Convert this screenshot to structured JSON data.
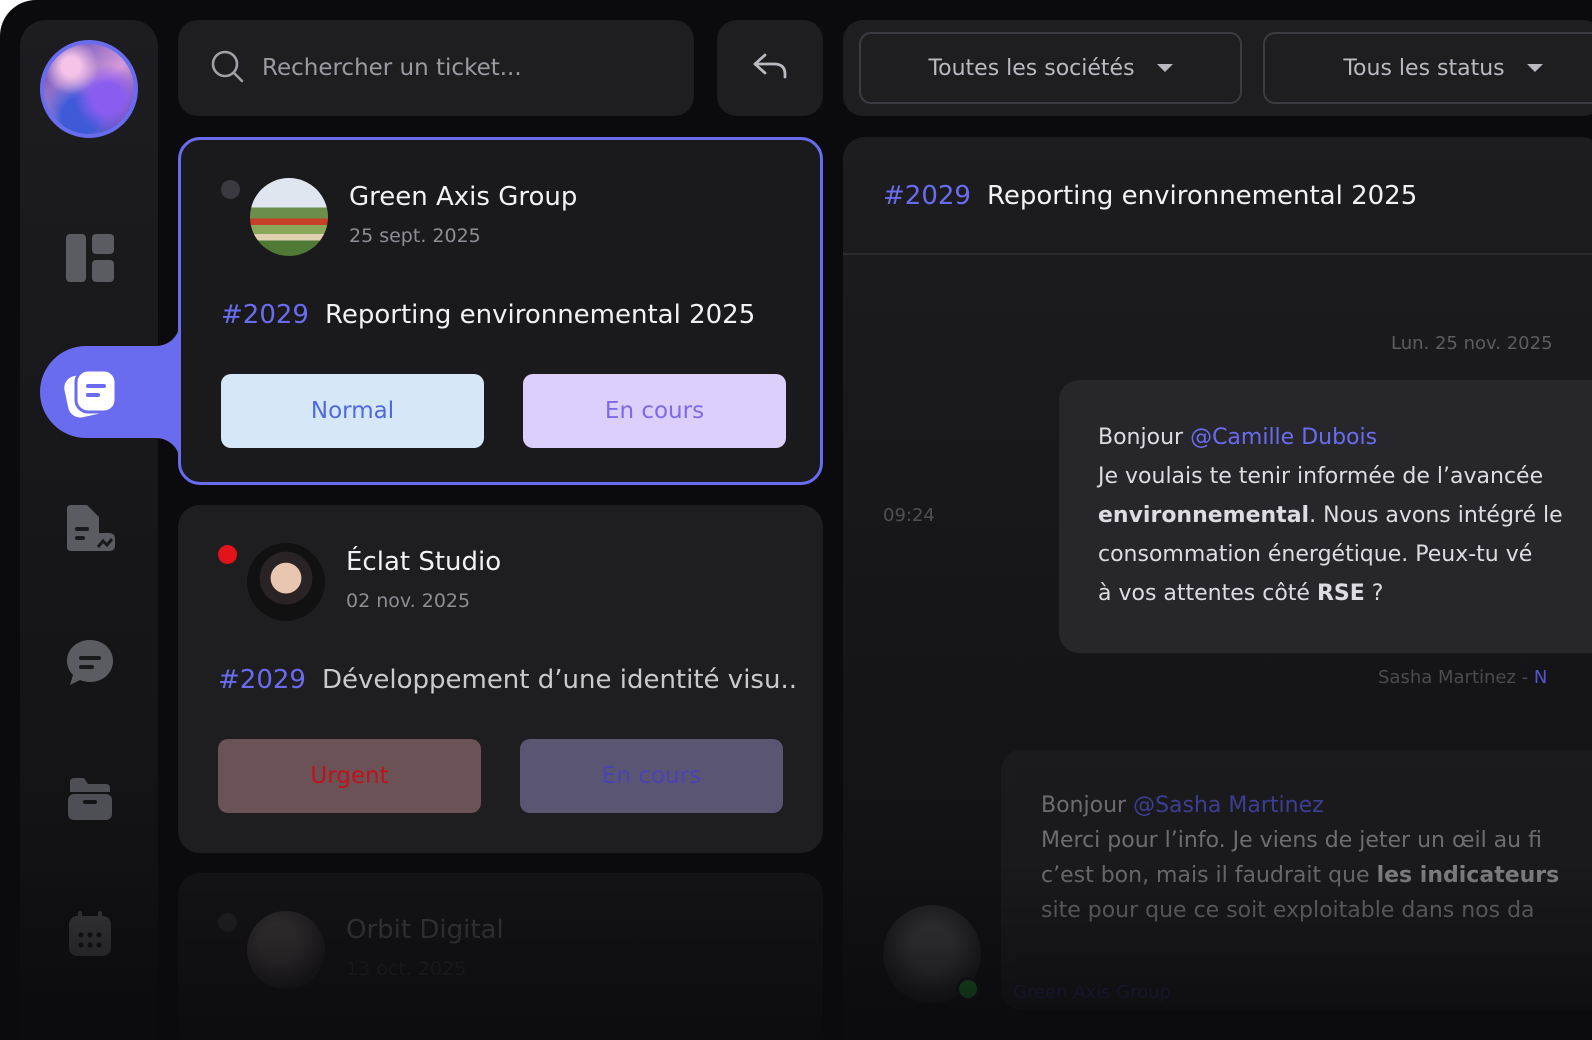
{
  "search": {
    "placeholder": "Rechercher un ticket..."
  },
  "filters": {
    "company": "Toutes les sociétés",
    "status": "Tous les status"
  },
  "tickets": [
    {
      "company": "Green Axis Group",
      "date": "25 sept. 2025",
      "number": "#2029",
      "title": "Reporting environnemental 2025",
      "priority": "Normal",
      "status": "En cours",
      "dot_color": "#3a3a40",
      "priority_bg": "#d6e7f7",
      "priority_fg": "#4f6ae0",
      "status_bg": "#dccffb",
      "status_fg": "#7e6ae8"
    },
    {
      "company": "Éclat Studio",
      "date": "02 nov. 2025",
      "number": "#2029",
      "title": "Développement d’une identité visu...",
      "priority": "Urgent",
      "status": "En cours",
      "dot_color": "#e3121b",
      "priority_bg": "#6a5256",
      "priority_fg": "#c0121a",
      "status_bg": "#5a5573",
      "status_fg": "#4b43b4"
    },
    {
      "company": "Orbit Digital",
      "date": "13 oct. 2025",
      "dot_color": "#2a2a2e"
    }
  ],
  "conversation": {
    "number": "#2029",
    "title": "Reporting environnemental 2025",
    "day": "Lun. 25 nov. 2025",
    "time": "09:24",
    "message1": {
      "greeting": "Bonjour",
      "mention": "@Camille Dubois",
      "line2": "Je voulais te tenir informée de l’avancée",
      "line3_bold": "environnemental",
      "line3_rest": ". Nous avons intégré le",
      "line4": "consommation énergétique. Peux-tu vé",
      "line5_start": "à vos attentes côté",
      "line5_bold": "RSE",
      "line5_end": "?"
    },
    "sender1_name": "Sasha Martinez -",
    "sender1_accent": "N",
    "message2": {
      "greeting": "Bonjour",
      "mention": "@Sasha Martinez",
      "line2": "Merci pour l’info. Je viens de jeter un œil au fi",
      "line3_start": "c’est bon, mais il faudrait que",
      "line3_bold": "les indicateurs",
      "line4": "site pour que ce soit exploitable dans nos da"
    },
    "sender2": "Green Axis Group"
  },
  "colors": {
    "accent": "#6a6cf0",
    "urgent": "#e3121b"
  }
}
